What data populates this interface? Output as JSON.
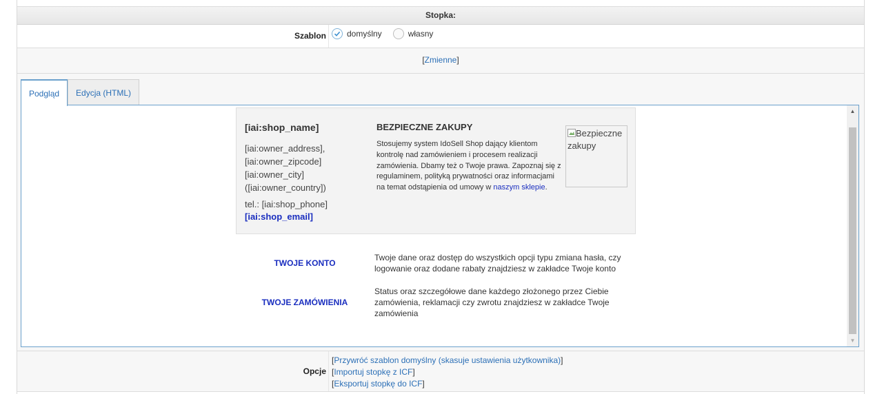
{
  "section_header": "Stopka:",
  "szablon": {
    "label": "Szablon",
    "options": [
      {
        "label": "domyślny",
        "checked": true
      },
      {
        "label": "własny",
        "checked": false
      }
    ]
  },
  "zmienne": {
    "open": "[",
    "link": "Zmienne",
    "close": "]"
  },
  "tabs": [
    {
      "label": "Podgląd",
      "active": true
    },
    {
      "label": "Edycja (HTML)",
      "active": false
    }
  ],
  "preview": {
    "shop_name": "[iai:shop_name]",
    "address_lines": [
      "[iai:owner_address],",
      "[iai:owner_zipcode]",
      "[iai:owner_city]",
      "([iai:owner_country])"
    ],
    "phone": "tel.: [iai:shop_phone]",
    "email": "[iai:shop_email]",
    "secure_title": "BEZPIECZNE ZAKUPY",
    "secure_text": "Stosujemy system IdoSell Shop dający klientom kontrolę nad zamówieniem i procesem realizacji zamówienia. Dbamy też o Twoje prawa. Zapoznaj się z regulaminem, polityką prywatności oraz informacjami na temat odstąpienia od umowy w",
    "secure_link": "naszym sklepie",
    "secure_link_suffix": ".",
    "secure_img_alt": "Bezpieczne zakupy",
    "account_label": "TWOJE KONTO",
    "account_text": "Twoje dane oraz dostęp do wszystkich opcji typu zmiana hasła, czy logowanie oraz dodane rabaty znajdziesz w zakładce Twoje konto",
    "orders_label": "TWOJE ZAMÓWIENIA",
    "orders_text": "Status oraz szczegółowe dane każdego złożonego przez Ciebie zamówienia, reklamacji czy zwrotu znajdziesz w zakładce Twoje zamówienia"
  },
  "opcje": {
    "label": "Opcje",
    "links": [
      "Przywróć szablon domyślny (skasuje ustawienia użytkownika)",
      "Importuj stopkę z ICF",
      "Eksportuj stopkę do ICF"
    ]
  },
  "colors": {
    "link": "#2b6fb6",
    "preview_link": "#1a2ebf",
    "tab_border": "#6aa0cc"
  }
}
